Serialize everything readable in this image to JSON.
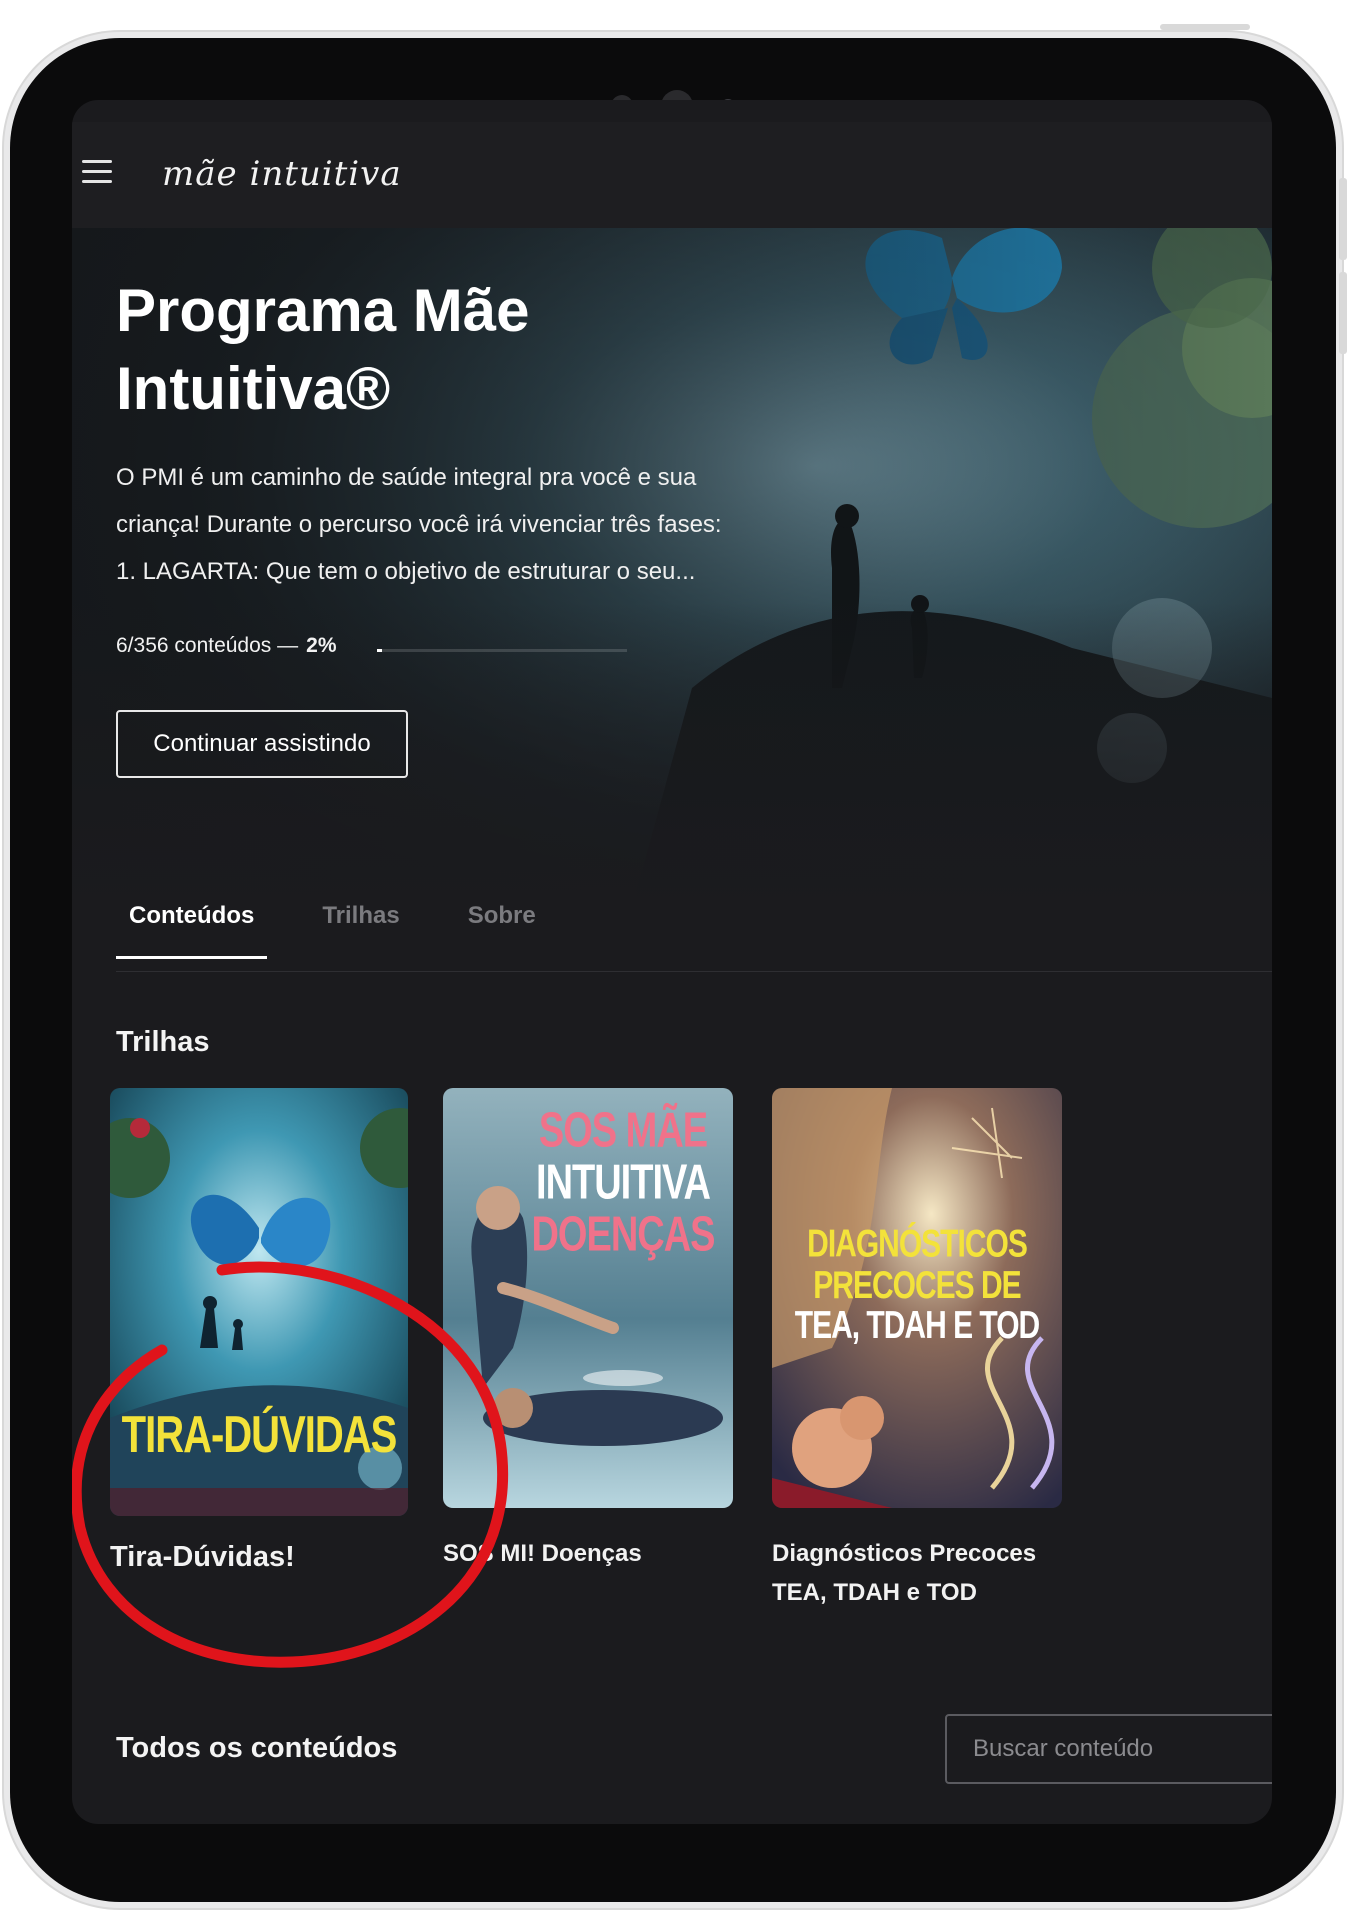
{
  "header": {
    "logo_text": "mãe intuitiva"
  },
  "hero": {
    "title": "Programa Mãe Intuitiva®",
    "description_lines": [
      "O PMI é um caminho de saúde integral pra você e sua",
      "criança! Durante o percurso você irá vivenciar três fases:",
      "1. LAGARTA: Que tem o objetivo de estruturar o seu..."
    ],
    "progress_text": "6/356 conteúdos —",
    "progress_percent_label": "2%",
    "progress_fraction": 0.02,
    "continue_button": "Continuar assistindo"
  },
  "tabs": [
    {
      "label": "Conteúdos",
      "active": true
    },
    {
      "label": "Trilhas",
      "active": false
    },
    {
      "label": "Sobre",
      "active": false
    }
  ],
  "trilhas": {
    "title": "Trilhas",
    "cards": [
      {
        "caption": "Tira-Dúvidas!",
        "poster_text": "TIRA-DÚVIDAS",
        "highlighted": true
      },
      {
        "caption": "SOS MI! Doenças",
        "poster_lines": [
          "SOS MÃE",
          "INTUITIVA",
          "DOENÇAS"
        ]
      },
      {
        "caption": "Diagnósticos Precoces TEA, TDAH e TOD",
        "poster_lines": [
          "DIAGNÓSTICOS",
          "PRECOCES DE",
          "TEA, TDAH E TOD"
        ]
      }
    ]
  },
  "all_contents": {
    "title": "Todos os conteúdos",
    "search_placeholder": "Buscar conteúdo"
  },
  "colors": {
    "background": "#1b1b1e",
    "highlight_circle": "#e0141b",
    "poster_yellow": "#f3e23a",
    "poster_pink": "#f0728a"
  },
  "icons": [
    "menu-icon",
    "camera-icon"
  ]
}
